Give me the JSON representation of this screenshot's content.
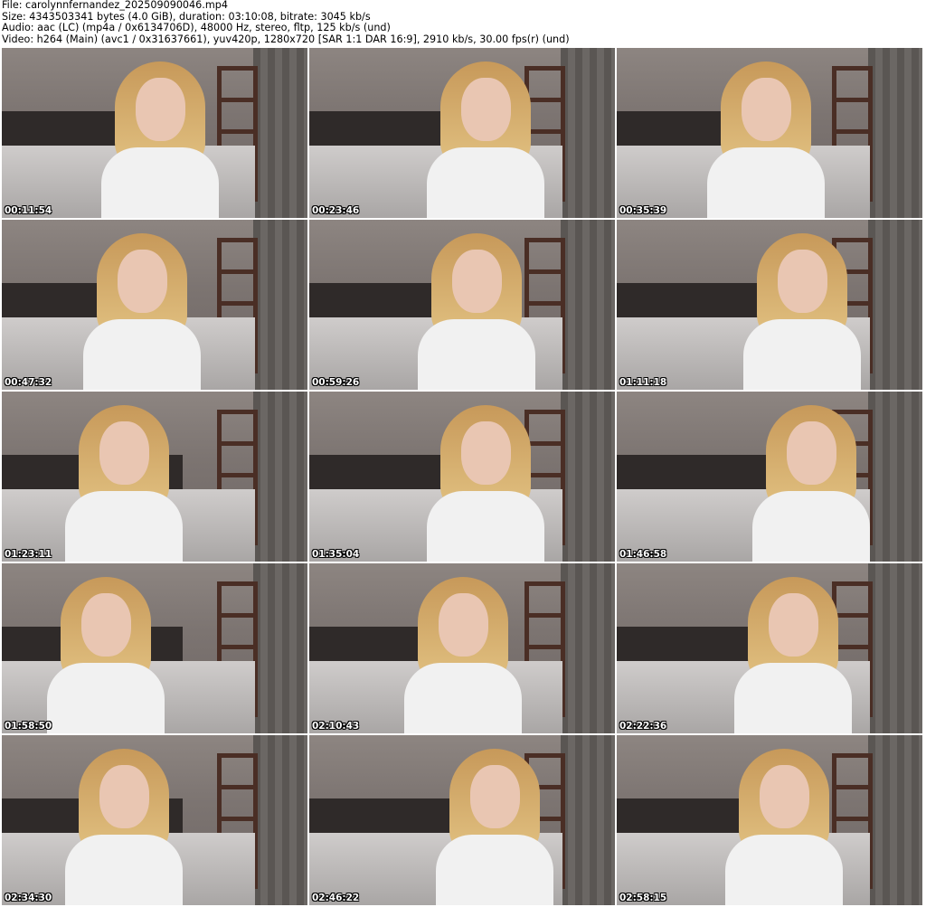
{
  "header": {
    "file": "File: carolynnfernandez_202509090046.mp4",
    "size": "Size: 4343503341 bytes (4.0 GiB), duration: 03:10:08, bitrate: 3045 kb/s",
    "audio": "Audio: aac (LC) (mp4a / 0x6134706D), 48000 Hz, stereo, fltp, 125 kb/s (und)",
    "video": "Video: h264 (Main) (avc1 / 0x31637661), yuv420p, 1280x720 [SAR 1:1 DAR 16:9], 2910 kb/s, 30.00 fps(r) (und)"
  },
  "thumbnails": [
    {
      "timestamp": "00:11:54"
    },
    {
      "timestamp": "00:23:46"
    },
    {
      "timestamp": "00:35:39"
    },
    {
      "timestamp": "00:47:32"
    },
    {
      "timestamp": "00:59:26"
    },
    {
      "timestamp": "01:11:18"
    },
    {
      "timestamp": "01:23:11"
    },
    {
      "timestamp": "01:35:04"
    },
    {
      "timestamp": "01:46:58"
    },
    {
      "timestamp": "01:58:50"
    },
    {
      "timestamp": "02:10:43"
    },
    {
      "timestamp": "02:22:36"
    },
    {
      "timestamp": "02:34:30"
    },
    {
      "timestamp": "02:46:22"
    },
    {
      "timestamp": "02:58:15"
    }
  ]
}
